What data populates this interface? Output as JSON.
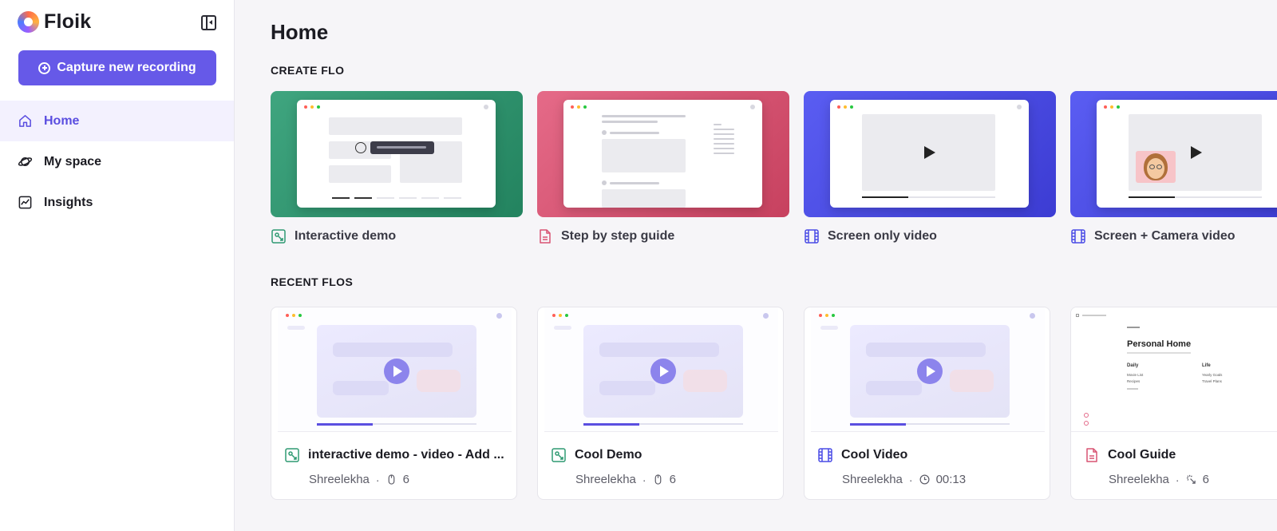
{
  "sidebar": {
    "brand": "Floik",
    "capture_button": "Capture new recording",
    "nav": [
      {
        "label": "Home",
        "icon": "home-icon",
        "active": true
      },
      {
        "label": "My space",
        "icon": "planet-icon",
        "active": false
      },
      {
        "label": "Insights",
        "icon": "chart-icon",
        "active": false
      }
    ]
  },
  "main": {
    "title": "Home",
    "create_section": "CREATE FLO",
    "create_cards": [
      {
        "label": "Interactive demo",
        "icon": "interactive-demo-icon",
        "color": "#2f9a72"
      },
      {
        "label": "Step by step guide",
        "icon": "document-icon",
        "color": "#d85372"
      },
      {
        "label": "Screen only video",
        "icon": "film-icon",
        "color": "#4a4ce6"
      },
      {
        "label": "Screen + Camera video",
        "icon": "film-icon",
        "color": "#4a4ce6"
      }
    ],
    "recent_section": "RECENT FLOS",
    "recent_cards": [
      {
        "title": "interactive demo - video - Add ...",
        "author": "Shreelekha",
        "sep": "·",
        "stat_icon": "mouse-icon",
        "stat": "6",
        "type_icon": "interactive-demo-icon"
      },
      {
        "title": "Cool Demo",
        "author": "Shreelekha",
        "sep": "·",
        "stat_icon": "mouse-icon",
        "stat": "6",
        "type_icon": "interactive-demo-icon"
      },
      {
        "title": "Cool Video",
        "author": "Shreelekha",
        "sep": "·",
        "stat_icon": "clock-icon",
        "stat": "00:13",
        "type_icon": "film-icon"
      },
      {
        "title": "Cool Guide",
        "author": "Shreelekha",
        "sep": "·",
        "stat_icon": "click-icon",
        "stat": "6",
        "type_icon": "document-icon"
      }
    ],
    "guide_preview": {
      "title": "Personal Home",
      "col1": "Daily",
      "col2": "Life",
      "col1_items": [
        "Movie List",
        "Recipes"
      ],
      "col2_items": [
        "Yearly Goals",
        "Travel Plans"
      ]
    }
  },
  "colors": {
    "accent": "#6659e8",
    "green": "#2f9a72",
    "red": "#d85372",
    "blue": "#4a4ce6"
  }
}
